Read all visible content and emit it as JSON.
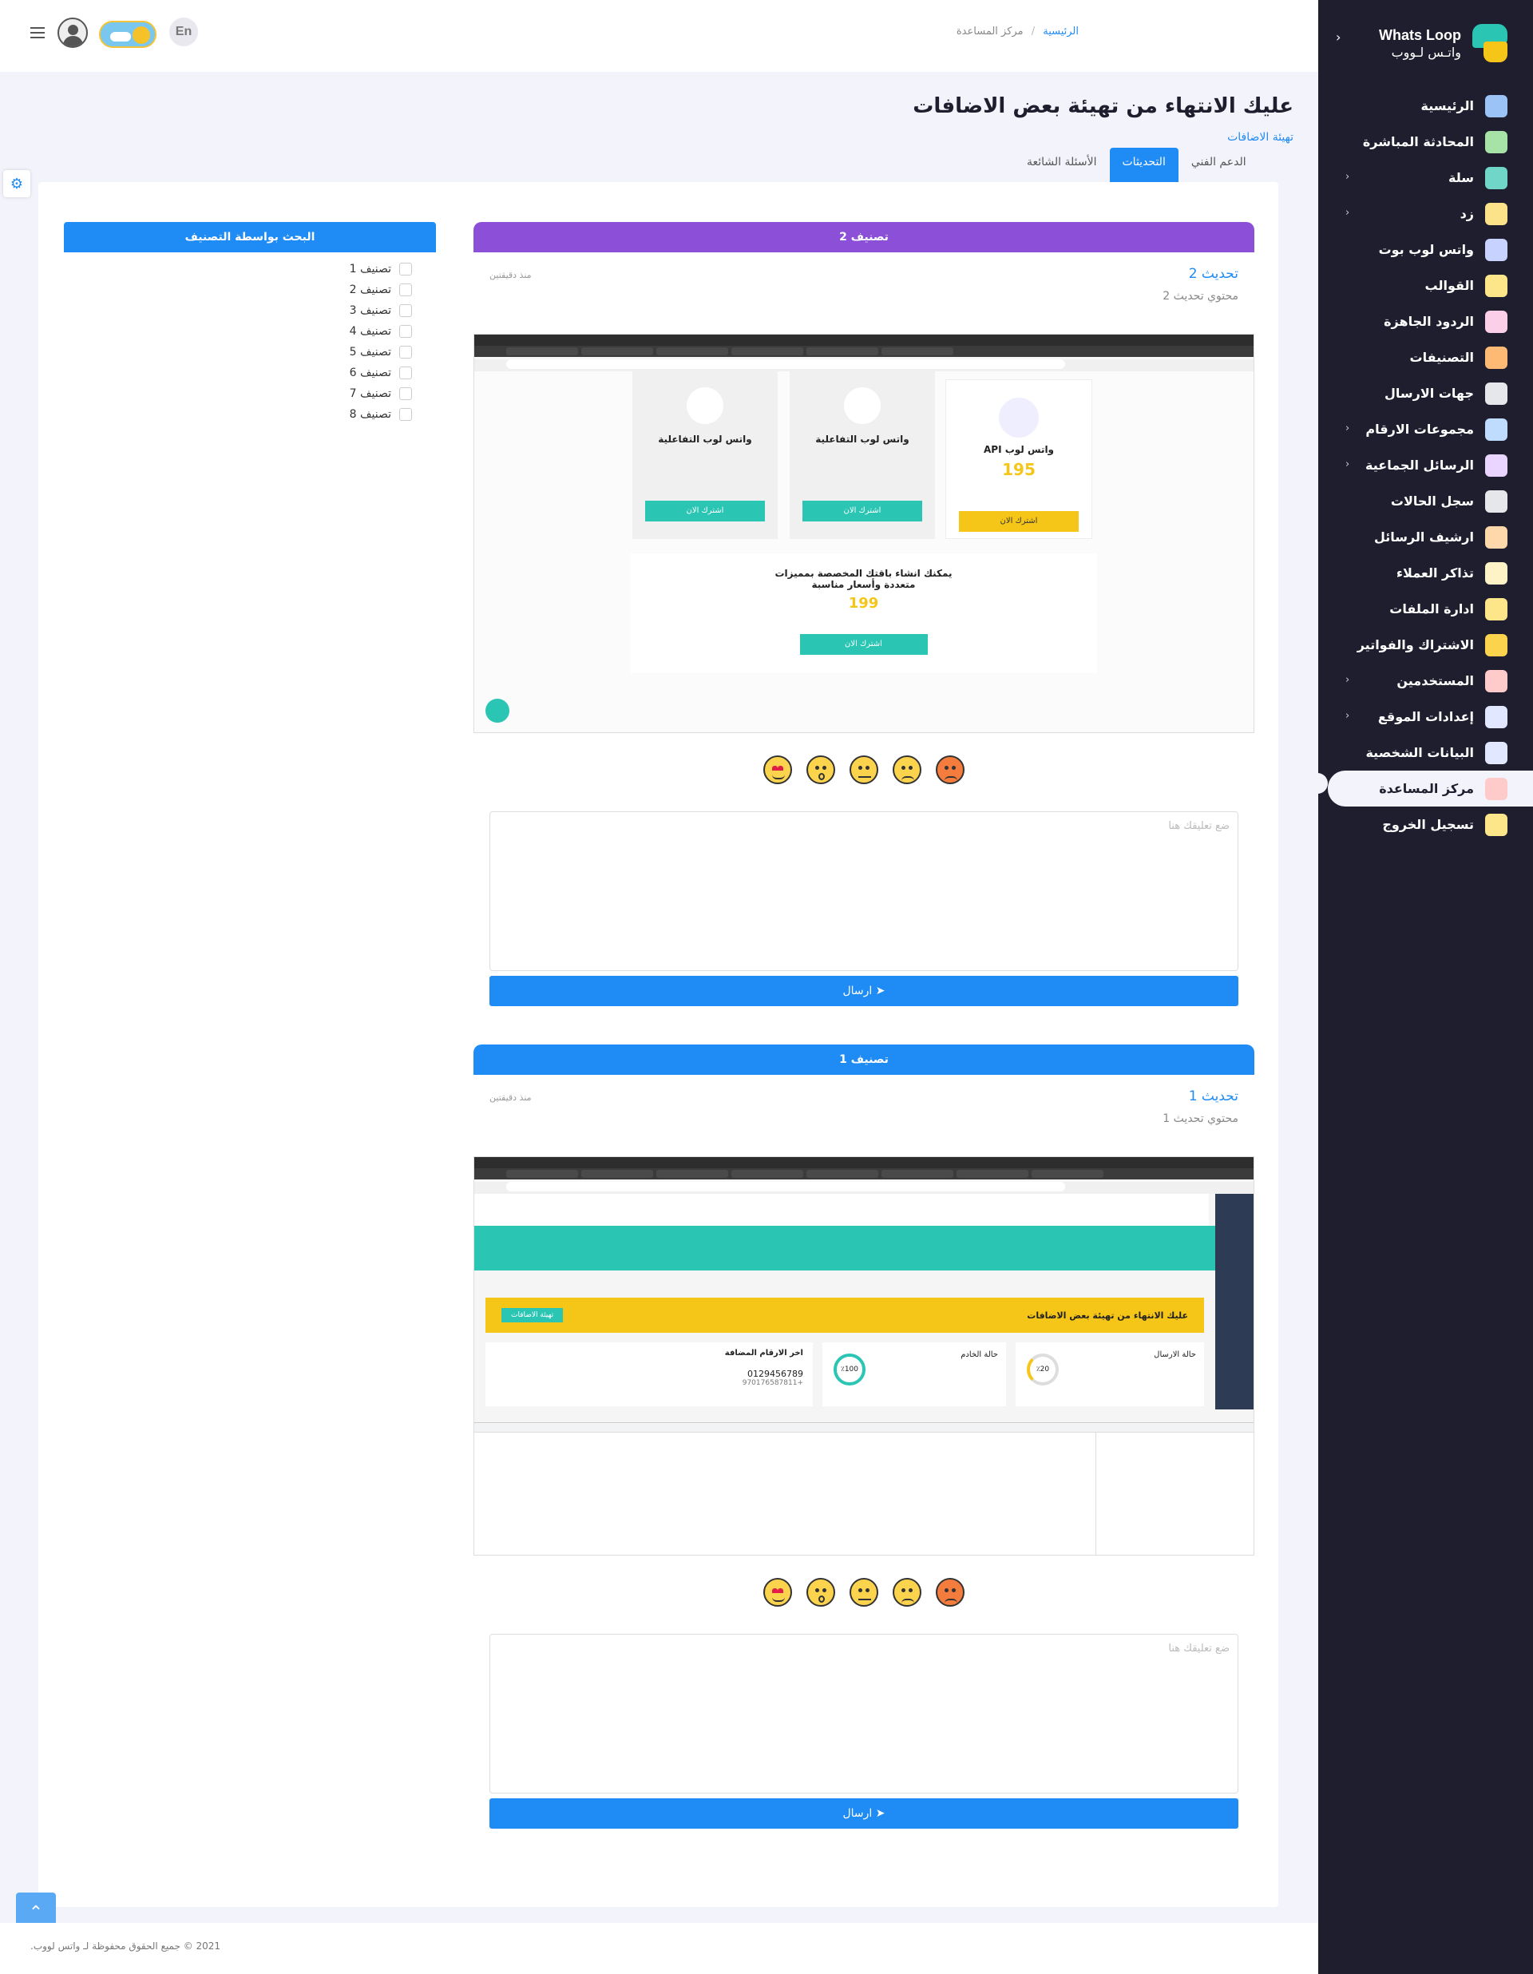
{
  "sidebar": {
    "logo_en": "Whats Loop",
    "logo_ar": "واتـس لـووب",
    "items": [
      {
        "label": "الرئيسية",
        "color": "#9cc3f5",
        "arrow": false
      },
      {
        "label": "المحادثة المباشرة",
        "color": "#a7e3a7",
        "arrow": false
      },
      {
        "label": "سلة",
        "color": "#6fd6c8",
        "arrow": true
      },
      {
        "label": "زد",
        "color": "#fce38a",
        "arrow": true
      },
      {
        "label": "واتس لوب بوت",
        "color": "#c7d2fe",
        "arrow": false
      },
      {
        "label": "القوالب",
        "color": "#fde68a",
        "arrow": false
      },
      {
        "label": "الردود الجاهزة",
        "color": "#fbcfe8",
        "arrow": false
      },
      {
        "label": "التصنيفات",
        "color": "#fdba74",
        "arrow": false
      },
      {
        "label": "جهات الارسال",
        "color": "#e5e7eb",
        "arrow": false
      },
      {
        "label": "مجموعات الارقام",
        "color": "#bfdbfe",
        "arrow": true
      },
      {
        "label": "الرسائل الجماعية",
        "color": "#e9d5ff",
        "arrow": true
      },
      {
        "label": "سجل الحالات",
        "color": "#e5e7eb",
        "arrow": false
      },
      {
        "label": "ارشيف الرسائل",
        "color": "#fed7aa",
        "arrow": false
      },
      {
        "label": "تذاكر العملاء",
        "color": "#fef3c7",
        "arrow": false
      },
      {
        "label": "ادارة الملفات",
        "color": "#fde68a",
        "arrow": false
      },
      {
        "label": "الاشتراك والفواتير",
        "color": "#fcd34d",
        "arrow": false
      },
      {
        "label": "المستخدمين",
        "color": "#fecaca",
        "arrow": true
      },
      {
        "label": "إعدادات الموقع",
        "color": "#e0e7ff",
        "arrow": true
      },
      {
        "label": "البيانات الشخصية",
        "color": "#e0e7ff",
        "arrow": false
      },
      {
        "label": "مركز المساعدة",
        "color": "#fecaca",
        "arrow": false,
        "active": true
      },
      {
        "label": "تسجيل الخروج",
        "color": "#fde68a",
        "arrow": false
      }
    ]
  },
  "topbar": {
    "lang": "En",
    "breadcrumb_home": "الرئيسية",
    "breadcrumb_sep": "/",
    "breadcrumb_current": "مركز المساعدة"
  },
  "page": {
    "title": "عليك الانتهاء من تهيئة بعض الاضافات",
    "subtitle": "تهيئة الاضافات"
  },
  "tabs": [
    "الدعم الفني",
    "التحديثات",
    "الأسئلة الشائعة"
  ],
  "active_tab": 1,
  "filter": {
    "title": "البحث بواسطة التصنيف",
    "categories": [
      "تصنيف 1",
      "تصنيف 2",
      "تصنيف 3",
      "تصنيف 4",
      "تصنيف 5",
      "تصنيف 6",
      "تصنيف 7",
      "تصنيف 8"
    ]
  },
  "posts": [
    {
      "category": "تصنيف 2",
      "head_color": "#8b4fd8",
      "title": "تحديث 2",
      "time": "منذ دقيقتين",
      "content": "محتوي تحديث 2",
      "comment_placeholder": "ضع تعليقك هنا",
      "send_label": "ارسال ➤"
    },
    {
      "category": "تصنيف 1",
      "head_color": "#1f8bf5",
      "title": "تحديث 1",
      "time": "منذ دقيقتين",
      "content": "محتوي تحديث 1",
      "comment_placeholder": "ضع تعليقك هنا",
      "send_label": "ارسال ➤"
    }
  ],
  "screenshot1": {
    "pkg_a_title": "واتس لوب API",
    "pkg_a_price": "195",
    "pkg_a_btn": "اشترك الان",
    "pkg_b_title": "واتس لوب التفاعلية",
    "pkg_b_btn": "اشترك الان",
    "pkg_c_title": "واتس لوب التفاعلية",
    "pkg_c_btn": "اشترك الان",
    "banner_text": "يمكنك انشاء باقتك المخصصة بمميزات متعددة وأسعار مناسبة",
    "banner_price": "199",
    "banner_btn": "اشترك الان"
  },
  "screenshot2": {
    "banner_text": "عليك الانتهاء من تهيئة بعض الاضافات",
    "banner_btn": "تهيئة الاضافات",
    "stat_a": "حالة الارسال",
    "stat_b": "حالة الخادم",
    "stat_c": "اخر الارقام المضافة",
    "stat_a_val": "٪20",
    "stat_b_val": "٪100",
    "phone_a": "0129456789",
    "phone_b": "+970176587811"
  },
  "footer": {
    "text": "2021 © جميع الحقوق محفوظة لـ واتس لووب."
  },
  "colors": {
    "accent": "#1f8bf5",
    "sidebar_bg": "#1f1e2e",
    "purple": "#8b4fd8"
  }
}
